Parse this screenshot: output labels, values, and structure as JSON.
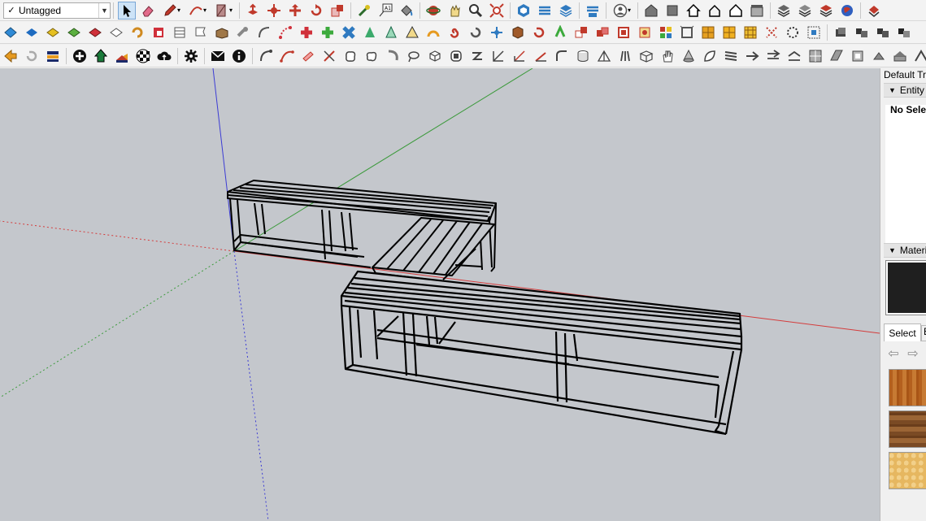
{
  "toolbar": {
    "tag_selector": {
      "value": "Untagged",
      "checkmark": "✓"
    },
    "row1_tools": [
      "select-tool-icon",
      "eraser-icon",
      "pencil-line-icon",
      "arc-tool-icon",
      "rectangle-tool-icon",
      "push-pull-icon",
      "move-icon",
      "rotate-icon",
      "scale-icon",
      "offset-icon",
      "tape-measure-icon",
      "text-tool-icon",
      "paint-bucket-icon",
      "orbit-icon",
      "pan-icon",
      "zoom-icon",
      "zoom-extents-icon",
      "components-icon",
      "sandbox-icon",
      "layers-icon",
      "solid-tools-icon",
      "user-account-icon",
      "warehouse-icon",
      "extension-icon",
      "home-icon",
      "house-outline-icon",
      "house-solid-icon",
      "warehouse-box-icon",
      "stack-icon",
      "stack-2-icon",
      "stack-3-icon",
      "globe-icon",
      "ext-red-icon"
    ],
    "row2_tools": [
      "blue-plane-icon",
      "blue-face-icon",
      "yellow-face-icon",
      "green-face-icon",
      "red-face-icon",
      "outline-face-icon",
      "rotate-face-icon",
      "red-square-icon",
      "lines-icon",
      "flag-icon",
      "box-open-icon",
      "wrench-icon",
      "curve-icon",
      "node-curve-icon",
      "red-cross-icon",
      "green-cross-icon",
      "blue-x-icon",
      "green-cone-icon",
      "cone-outline-icon",
      "warning-triangle-icon",
      "orange-arc-icon",
      "spiral-icon",
      "rotate-arrow-icon",
      "move-arrows-icon",
      "brown-cube-icon",
      "red-loop-icon",
      "green-cut-icon",
      "multi-cube-icon",
      "red-cube-icon",
      "red-cube-2-icon",
      "red-diamond-icon",
      "grid-tile-icon",
      "frame-icon",
      "orange-grid-icon",
      "orange-grid-2-icon",
      "orange-grid-3-icon",
      "red-dots-icon",
      "dotted-circle-icon",
      "dots-grid-icon",
      "dark-cube-icon",
      "dark-cubes-icon",
      "dark-cubes-2-icon",
      "dark-cubes-3-icon"
    ],
    "row3_tools": [
      "orange-arrows-icon",
      "refresh-icon",
      "flag-stack-icon",
      "plus-circle-icon",
      "tree-icon",
      "sun-icon",
      "checker-ball-icon",
      "cloud-icon",
      "settings-gear-icon",
      "mail-icon",
      "info-icon",
      "curve-tool-icon",
      "red-curve-icon",
      "paint-icon",
      "knife-icon",
      "blob-icon",
      "blob-2-icon",
      "hook-icon",
      "lasso-icon",
      "box-3d-icon",
      "round-box-icon",
      "zigzag-icon",
      "slash-line-icon",
      "angle-icon",
      "red-slash-icon",
      "bend-icon",
      "cylinder-icon",
      "tent-icon",
      "lines-3-icon",
      "grid-3d-icon",
      "hand-icon",
      "cone-icon",
      "leaf-icon",
      "stack-lines-icon",
      "arrow-split-icon",
      "arrow-split-2-icon",
      "arrow-split-3-icon",
      "tile-icon",
      "tile-2-icon",
      "tile-3-icon",
      "arrow-back-icon",
      "arrow-fwd-icon",
      "wave-icon"
    ]
  },
  "tray": {
    "title": "Default Tray",
    "entity_info": {
      "label": "Entity Info",
      "status": "No Selection"
    },
    "materials": {
      "label": "Materials",
      "swatch_color": "#1f1f1f",
      "select_tab": "Select",
      "edit_tab": "E"
    }
  },
  "viewport": {
    "background": "#c4c7cc",
    "axis_colors": {
      "red": "#d43c3c",
      "green": "#3c9a3c",
      "blue": "#3c3cd4"
    },
    "model": "L-shaped bench (two benches joined by a corner seat)"
  }
}
